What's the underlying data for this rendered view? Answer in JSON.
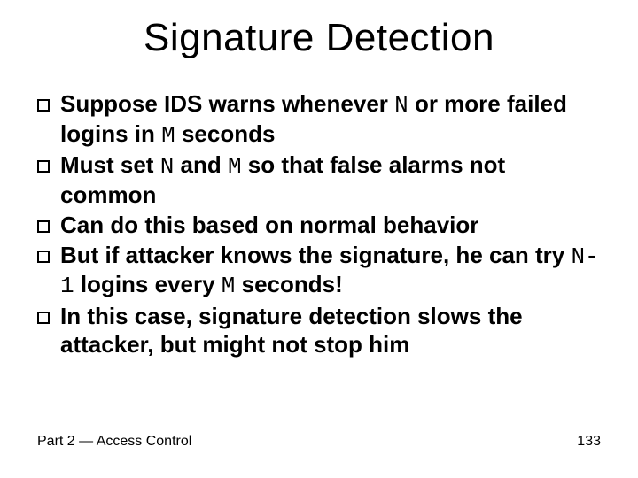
{
  "title": "Signature Detection",
  "bullets": {
    "b0": {
      "a": "Suppose IDS warns whenever ",
      "n": "N",
      "b": " or more failed logins in ",
      "m": "M",
      "c": " seconds"
    },
    "b1": {
      "a": "Must set ",
      "n": "N",
      "b": " and ",
      "m": "M",
      "c": " so that false alarms not common"
    },
    "b2": {
      "a": "Can do this based on normal behavior"
    },
    "b3": {
      "a": "But if attacker knows the signature, he can try ",
      "n": "N-1",
      "b": " logins every ",
      "m": "M",
      "c": " seconds!"
    },
    "b4": {
      "a": "In this case, signature detection slows the attacker, but might not stop him"
    }
  },
  "footer": {
    "part": "Part 2 ",
    "dash": "—",
    "rest": " Access Control",
    "page": "133"
  }
}
